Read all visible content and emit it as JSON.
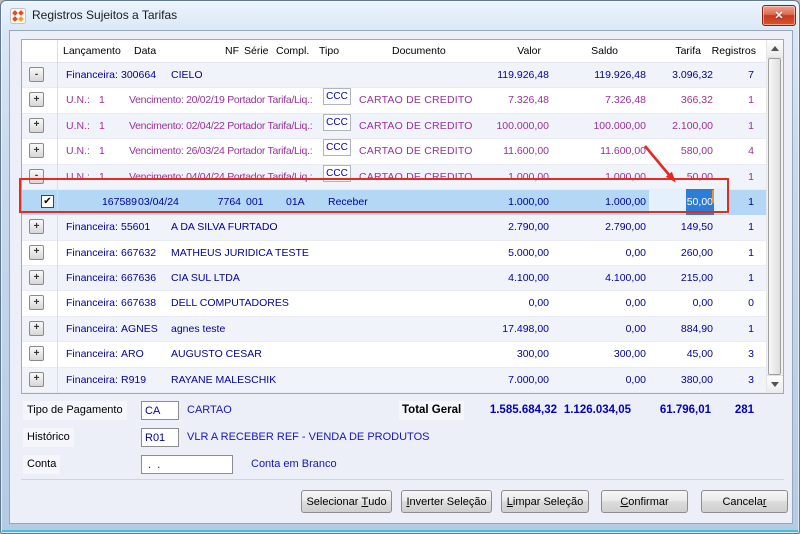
{
  "window": {
    "title": "Registros Sujeitos a Tarifas"
  },
  "icons": {
    "close": "✕",
    "check": "✔"
  },
  "colors": {
    "navy_text": "#0000A0",
    "purple_text": "#9B309B",
    "selection_blue": "#2F7CD8",
    "selected_row": "#B3D7F4",
    "annotation_red": "#E32B20",
    "link_blue": "#1414CC"
  },
  "table": {
    "headers": [
      "Lançamento",
      "Data",
      "NF",
      "Série",
      "Compl.",
      "Tipo",
      "Documento",
      "Valor",
      "Saldo",
      "Tarifa",
      "Registros"
    ],
    "rows": [
      {
        "type": "group",
        "expander": "-",
        "label": "Financeira:",
        "code": "300664",
        "name": "CIELO",
        "valor": "119.926,48",
        "saldo": "119.926,48",
        "tarifa": "3.096,32",
        "registros": "7"
      },
      {
        "type": "un",
        "expander": "+",
        "label": "U.N.:",
        "un": "1",
        "venc": "Vencimento: 20/02/19 Portador Tarifa/Liq.:",
        "ccc": "CCC",
        "doc": "CARTAO DE CREDITO",
        "valor": "7.326,48",
        "saldo": "7.326,48",
        "tarifa": "366,32",
        "registros": "1"
      },
      {
        "type": "un",
        "expander": "+",
        "label": "U.N.:",
        "un": "1",
        "venc": "Vencimento: 02/04/22 Portador Tarifa/Liq.:",
        "ccc": "CCC",
        "doc": "CARTAO DE CREDITO",
        "valor": "100.000,00",
        "saldo": "100.000,00",
        "tarifa": "2.100,00",
        "registros": "1"
      },
      {
        "type": "un",
        "expander": "+",
        "label": "U.N.:",
        "un": "1",
        "venc": "Vencimento: 26/03/24 Portador Tarifa/Liq.:",
        "ccc": "CCC",
        "doc": "CARTAO DE CREDITO",
        "valor": "11.600,00",
        "saldo": "11.600,00",
        "tarifa": "580,00",
        "registros": "4"
      },
      {
        "type": "un",
        "expander": "-",
        "label": "U.N.:",
        "un": "1",
        "venc": "Vencimento: 04/04/24 Portador Tarifa/Liq.:",
        "ccc": "CCC",
        "doc": "CARTAO DE CREDITO",
        "valor": "1.000,00",
        "saldo": "1.000,00",
        "tarifa": "50,00",
        "registros": "1"
      },
      {
        "type": "detail",
        "checked": true,
        "lancamento": "167589",
        "data": "03/04/24",
        "nf": "7764",
        "serie": "001",
        "compl": "01A",
        "tipo": "Receber",
        "valor": "1.000,00",
        "saldo": "1.000,00",
        "tarifa_edit": "50,00",
        "registros": "1"
      },
      {
        "type": "group",
        "expander": "+",
        "label": "Financeira:",
        "code": "55601",
        "name": "A DA SILVA FURTADO",
        "valor": "2.790,00",
        "saldo": "2.790,00",
        "tarifa": "149,50",
        "registros": "1"
      },
      {
        "type": "group",
        "expander": "+",
        "label": "Financeira:",
        "code": "667632",
        "name": "MATHEUS JURIDICA TESTE",
        "valor": "5.000,00",
        "saldo": "0,00",
        "tarifa": "260,00",
        "registros": "1"
      },
      {
        "type": "group",
        "expander": "+",
        "label": "Financeira:",
        "code": "667636",
        "name": "CIA SUL LTDA",
        "valor": "4.100,00",
        "saldo": "4.100,00",
        "tarifa": "215,00",
        "registros": "1"
      },
      {
        "type": "group",
        "expander": "+",
        "label": "Financeira:",
        "code": "667638",
        "name": "DELL COMPUTADORES",
        "valor": "0,00",
        "saldo": "0,00",
        "tarifa": "0,00",
        "registros": "0"
      },
      {
        "type": "group",
        "expander": "+",
        "label": "Financeira:",
        "code": "AGNES",
        "name": "agnes teste",
        "valor": "17.498,00",
        "saldo": "0,00",
        "tarifa": "884,90",
        "registros": "1"
      },
      {
        "type": "group",
        "expander": "+",
        "label": "Financeira:",
        "code": "ARO",
        "name": "AUGUSTO CESAR",
        "valor": "300,00",
        "saldo": "300,00",
        "tarifa": "45,00",
        "registros": "3"
      },
      {
        "type": "group",
        "expander": "+",
        "label": "Financeira:",
        "code": "R919",
        "name": "RAYANE MALESCHIK",
        "valor": "7.000,00",
        "saldo": "0,00",
        "tarifa": "380,00",
        "registros": "3"
      }
    ]
  },
  "footer": {
    "fields": [
      {
        "label": "Tipo de Pagamento",
        "value": "CA",
        "desc": "CARTAO"
      },
      {
        "label": "Histórico",
        "value": "R01",
        "desc": "VLR A RECEBER REF - VENDA DE PRODUTOS"
      },
      {
        "label": "Conta",
        "value": " .  . ",
        "desc": "Conta em Branco"
      }
    ],
    "total": {
      "label": "Total Geral",
      "valor": "1.585.684,32",
      "saldo": "1.126.034,05",
      "tarifa": "61.796,01",
      "registros": "281"
    }
  },
  "buttons": [
    {
      "pre": "Selecionar ",
      "key": "T",
      "post": "udo"
    },
    {
      "pre": "",
      "key": "I",
      "post": "nverter Seleção"
    },
    {
      "pre": "",
      "key": "L",
      "post": "impar Seleção"
    },
    {
      "pre": "",
      "key": "C",
      "post": "onfirmar"
    },
    {
      "pre": "Cancela",
      "key": "r",
      "post": ""
    }
  ]
}
